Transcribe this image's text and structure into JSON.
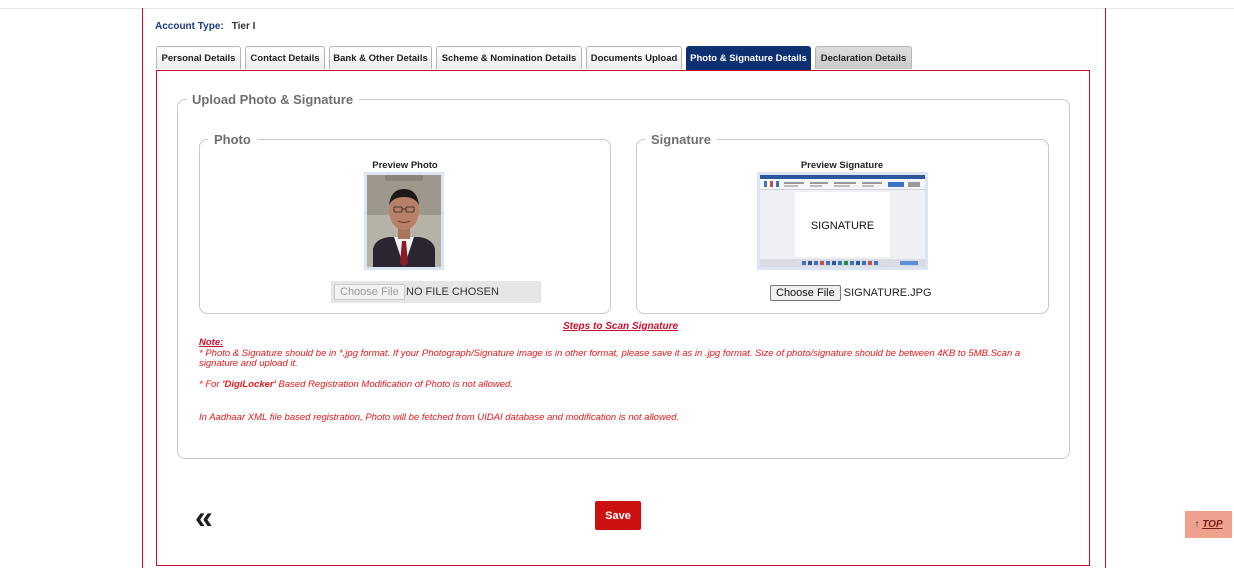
{
  "account": {
    "label": "Account Type:",
    "value": "Tier I"
  },
  "tabs": [
    {
      "label": "Personal Details"
    },
    {
      "label": "Contact Details"
    },
    {
      "label": "Bank & Other Details"
    },
    {
      "label": "Scheme & Nomination Details"
    },
    {
      "label": "Documents Upload"
    },
    {
      "label": "Photo & Signature Details"
    },
    {
      "label": "Declaration Details"
    }
  ],
  "active_tab": "Photo & Signature Details",
  "section": {
    "title": "Upload Photo & Signature",
    "photo": {
      "legend": "Photo",
      "preview_label": "Preview Photo",
      "choose_button": "Choose File",
      "file_name": "NO FILE CHOSEN",
      "disabled": true
    },
    "signature": {
      "legend": "Signature",
      "preview_label": "Preview Signature",
      "preview_text": "SIGNATURE",
      "choose_button": "Choose File",
      "file_name": "SIGNATURE.JPG"
    }
  },
  "steps_link": "Steps to Scan Signature",
  "notes": {
    "header": "Note:",
    "line1": "* Photo & Signature should be in *.jpg format. If your Photograph/Signature image is in other format, please save it as in .jpg format. Size of photo/signature should be between 4KB to 5MB.Scan a signature and upload it.",
    "line2_prefix": "* For ",
    "line2_bold": "'DigiLocker'",
    "line2_suffix": " Based Registration Modification of Photo is not allowed.",
    "line3": "In Aadhaar XML file based registration, Photo will be fetched from UIDAI database and modification is not allowed."
  },
  "back_icon": "«",
  "save_label": "Save",
  "top_button": {
    "arrow": "↑",
    "label": "TOP"
  },
  "colors": {
    "accent_red": "#c8102e",
    "active_tab": "#0d3170",
    "save": "#cc1111",
    "top_bg": "#eea28d"
  }
}
